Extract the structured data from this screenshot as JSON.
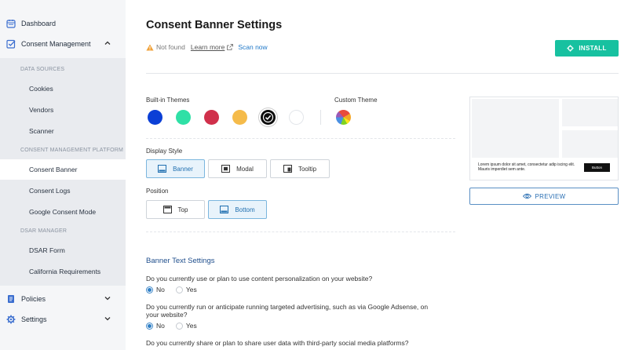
{
  "sidebar": {
    "dashboard": "Dashboard",
    "consent_management": "Consent Management",
    "section_data_sources": "DATA SOURCES",
    "cookies": "Cookies",
    "vendors": "Vendors",
    "scanner": "Scanner",
    "section_cmp": "CONSENT MANAGEMENT PLATFORM",
    "consent_banner": "Consent Banner",
    "consent_logs": "Consent Logs",
    "google_consent_mode": "Google Consent Mode",
    "section_dsar": "DSAR MANAGER",
    "dsar_form": "DSAR Form",
    "california": "California Requirements",
    "policies": "Policies",
    "settings": "Settings"
  },
  "main": {
    "title": "Consent Banner Settings",
    "status": "Not found",
    "learn_more": "Learn more",
    "scan_now": "Scan now",
    "install": "INSTALL",
    "builtin_themes_label": "Built-in Themes",
    "custom_theme_label": "Custom Theme",
    "themes": [
      {
        "name": "blue",
        "color": "#0b3fd6"
      },
      {
        "name": "teal",
        "color": "#2fe0a6"
      },
      {
        "name": "red",
        "color": "#d0304b"
      },
      {
        "name": "yellow",
        "color": "#f5bb4a"
      },
      {
        "name": "black",
        "color": "#0d0d0d",
        "selected": true
      },
      {
        "name": "white",
        "color": "#ffffff"
      }
    ],
    "display_style_label": "Display Style",
    "display_styles": [
      "Banner",
      "Modal",
      "Tooltip"
    ],
    "display_style_selected": "Banner",
    "position_label": "Position",
    "positions": [
      "Top",
      "Bottom"
    ],
    "position_selected": "Bottom",
    "banner_text_title": "Banner Text Settings",
    "q1": "Do you currently use or plan to use content personalization on your website?",
    "q1_answer": "No",
    "q2": "Do you currently run or anticipate running targeted advertising, such as via Google Adsense, on your website?",
    "q2_answer": "No",
    "q3": "Do you currently share or plan to share user data with third-party social media platforms?",
    "opt_no": "No",
    "opt_yes": "Yes"
  },
  "preview": {
    "text": "Lorem ipsum dolor sit amet, consectetur adip iscing elit. Mauris imperdiet sem ante.",
    "button": "Button",
    "preview_button": "PREVIEW"
  },
  "colors": {
    "accent": "#17c1a0",
    "link": "#1f78c8",
    "selected_bg": "#e8f3fb"
  }
}
